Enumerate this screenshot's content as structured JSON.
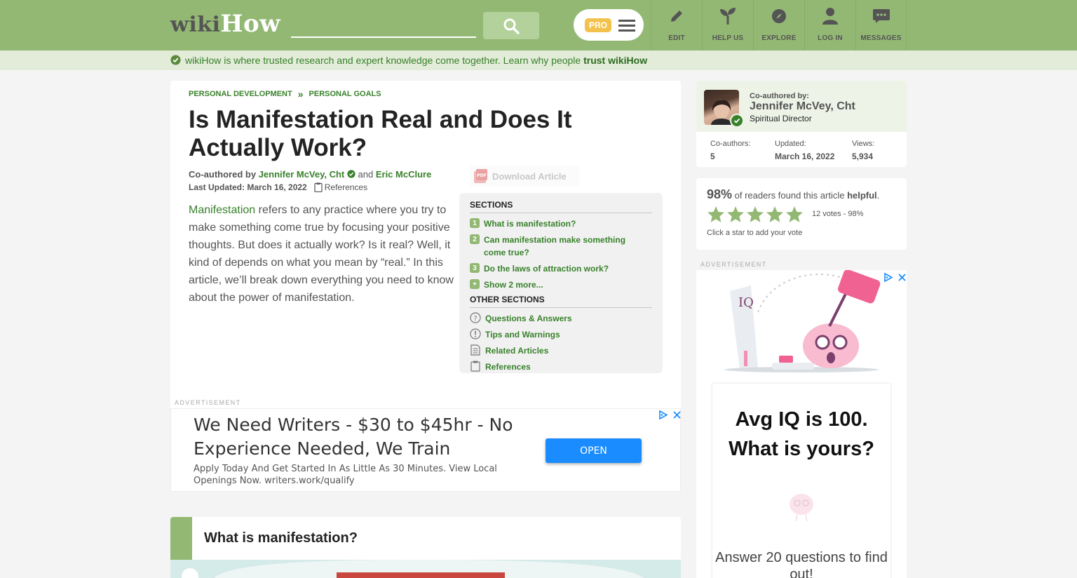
{
  "header": {
    "logo_wiki": "wiki",
    "logo_how": "How",
    "search_value": "",
    "pro_label": "PRO",
    "nav": [
      {
        "label": "EDIT",
        "icon": "pencil-icon"
      },
      {
        "label": "HELP US",
        "icon": "sprout-icon"
      },
      {
        "label": "EXPLORE",
        "icon": "compass-icon"
      },
      {
        "label": "LOG IN",
        "icon": "user-icon"
      },
      {
        "label": "MESSAGES",
        "icon": "chat-icon"
      }
    ]
  },
  "trust_bar": {
    "text": "wikiHow is where trusted research and expert knowledge come together. Learn why people",
    "link": "trust wikiHow"
  },
  "article": {
    "breadcrumb": [
      "PERSONAL DEVELOPMENT",
      "PERSONAL GOALS"
    ],
    "breadcrumb_sep": "»",
    "title": "Is Manifestation Real and Does It Actually Work?",
    "byline_prefix": "Co-authored by",
    "author1": "Jennifer McVey, Cht",
    "byline_and": "and",
    "author2": "Eric McClure",
    "last_updated": "Last Updated: March 16, 2022",
    "references_label": "References",
    "download_label": "Download Article",
    "intro_link": "Manifestation",
    "intro_rest": " refers to any practice where you try to make something come true by focusing your positive thoughts. But does it actually work? Is it real? Well, it kind of depends on what you mean by “real.” In this article, we’ll break down everything you need to know about the power of manifestation."
  },
  "toc": {
    "sections_head": "SECTIONS",
    "sections": [
      {
        "num": "1",
        "label": "What is manifestation?"
      },
      {
        "num": "2",
        "label": "Can manifestation make something come true?"
      },
      {
        "num": "3",
        "label": "Do the laws of attraction work?"
      },
      {
        "num": "+",
        "label": "Show 2 more..."
      }
    ],
    "other_head": "OTHER SECTIONS",
    "other": [
      {
        "label": "Questions & Answers",
        "icon": "question-icon"
      },
      {
        "label": "Tips and Warnings",
        "icon": "exclamation-icon"
      },
      {
        "label": "Related Articles",
        "icon": "document-icon"
      },
      {
        "label": "References",
        "icon": "clipboard-icon"
      }
    ]
  },
  "ad_main": {
    "label": "ADVERTISEMENT",
    "headline": "We Need Writers - $30 to $45hr - No Experience Needed, We Train",
    "body": "Apply Today And Get Started In As Little As 30 Minutes. View Local Openings Now. writers.work/qualify",
    "cta": "OPEN"
  },
  "section1": {
    "title": "What is manifestation?"
  },
  "sidebar": {
    "coauth_label": "Co-authored by:",
    "author_name": "Jennifer McVey, Cht",
    "author_role": "Spiritual Director",
    "stats": [
      {
        "label": "Co-authors:",
        "value": "5"
      },
      {
        "label": "Updated:",
        "value": "March 16, 2022"
      },
      {
        "label": "Views:",
        "value": "5,934"
      }
    ],
    "rating_pct": "98%",
    "rating_text": " of readers found this article ",
    "rating_word": "helpful",
    "rating_period": ".",
    "stars": 5,
    "votes": "12 votes - 98%",
    "vote_hint": "Click a star to add your vote"
  },
  "ad_side": {
    "label": "ADVERTISEMENT",
    "title": "Avg IQ is 100. What is yours?",
    "sub": "Answer 20 questions to find out!",
    "iq_label": "IQ"
  },
  "colors": {
    "brand_green": "#93b874",
    "link_green": "#38812b",
    "ad_button": "#1a8cff",
    "pro_badge": "#f2c24d"
  }
}
